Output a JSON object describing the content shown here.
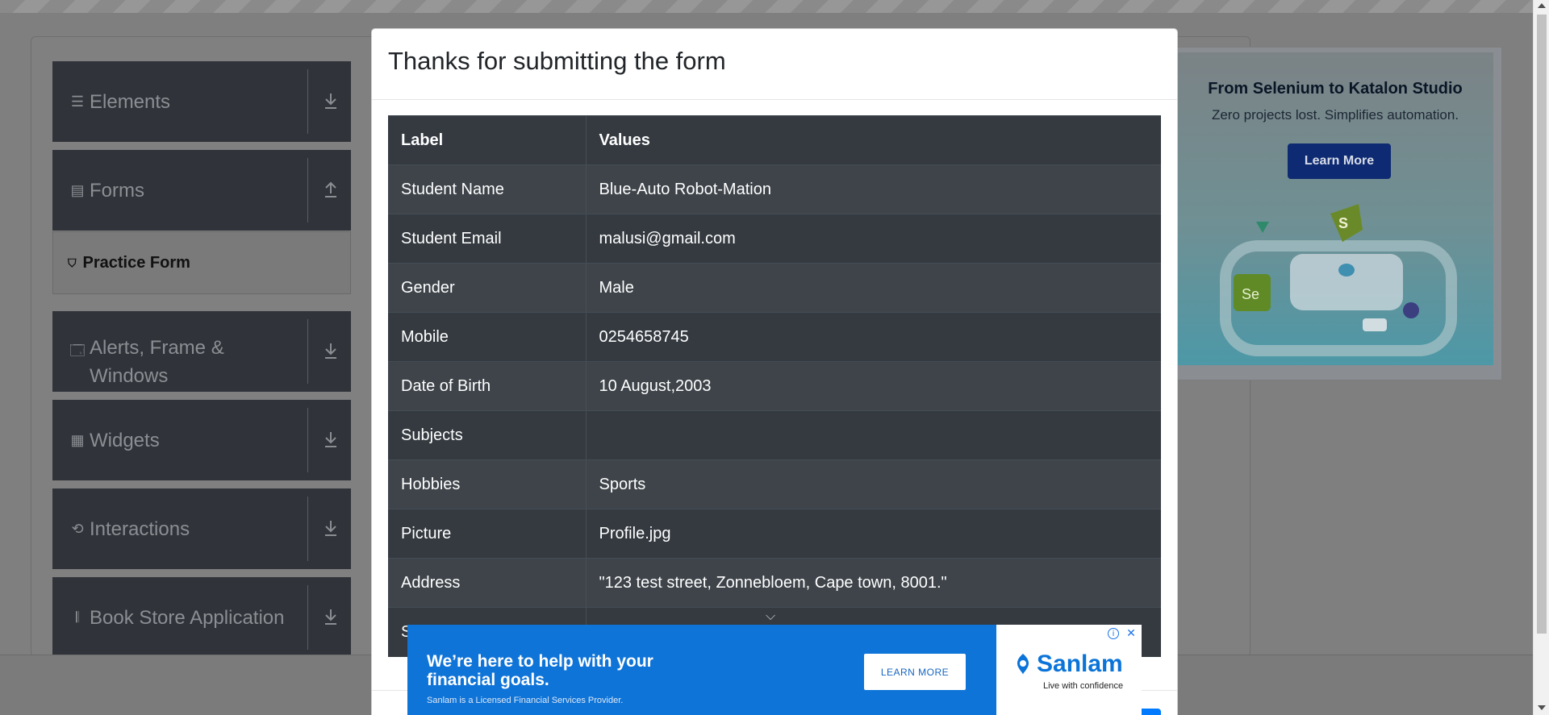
{
  "sidebar": {
    "groups": [
      {
        "label": "Elements",
        "icon": "hamburger-icon",
        "arrow": "download-arrow-icon"
      },
      {
        "label": "Forms",
        "icon": "document-icon",
        "arrow": "upload-arrow-icon"
      },
      {
        "label": "Alerts, Frame & Windows",
        "icon": "window-icon",
        "arrow": "download-arrow-icon"
      },
      {
        "label": "Widgets",
        "icon": "widgets-icon",
        "arrow": "download-arrow-icon"
      },
      {
        "label": "Interactions",
        "icon": "refresh-icon",
        "arrow": "download-arrow-icon"
      },
      {
        "label": "Book Store Application",
        "icon": "books-icon",
        "arrow": "download-arrow-icon"
      }
    ],
    "active_item": "Practice Form"
  },
  "modal": {
    "title": "Thanks for submitting the form",
    "table": {
      "headers": [
        "Label",
        "Values"
      ],
      "rows": [
        [
          "Student Name",
          "Blue-Auto Robot-Mation"
        ],
        [
          "Student Email",
          "malusi@gmail.com"
        ],
        [
          "Gender",
          "Male"
        ],
        [
          "Mobile",
          "0254658745"
        ],
        [
          "Date of Birth",
          "10 August,2003"
        ],
        [
          "Subjects",
          ""
        ],
        [
          "Hobbies",
          "Sports"
        ],
        [
          "Picture",
          "Profile.jpg"
        ],
        [
          "Address",
          "\"123 test street, Zonnebloem, Cape town, 8001.\""
        ],
        [
          "S",
          ""
        ]
      ]
    }
  },
  "ad_right": {
    "title": "From Selenium to Katalon Studio",
    "subtitle": "Zero projects lost. Simplifies automation.",
    "button": "Learn More"
  },
  "ad_bottom": {
    "headline": "We’re here to help with your financial goals.",
    "fine_print": "Sanlam is a Licensed Financial Services Provider.",
    "button": "LEARN MORE",
    "brand": "Sanlam",
    "tagline": "Live with confidence",
    "info_icon": "i",
    "close_icon": "✕"
  },
  "colors": {
    "sidebar_bg": "#30343a",
    "table_dark": "#343a40",
    "table_stripe": "#3e444a",
    "ad_blue": "#0f74d8",
    "primary": "#007bff"
  }
}
